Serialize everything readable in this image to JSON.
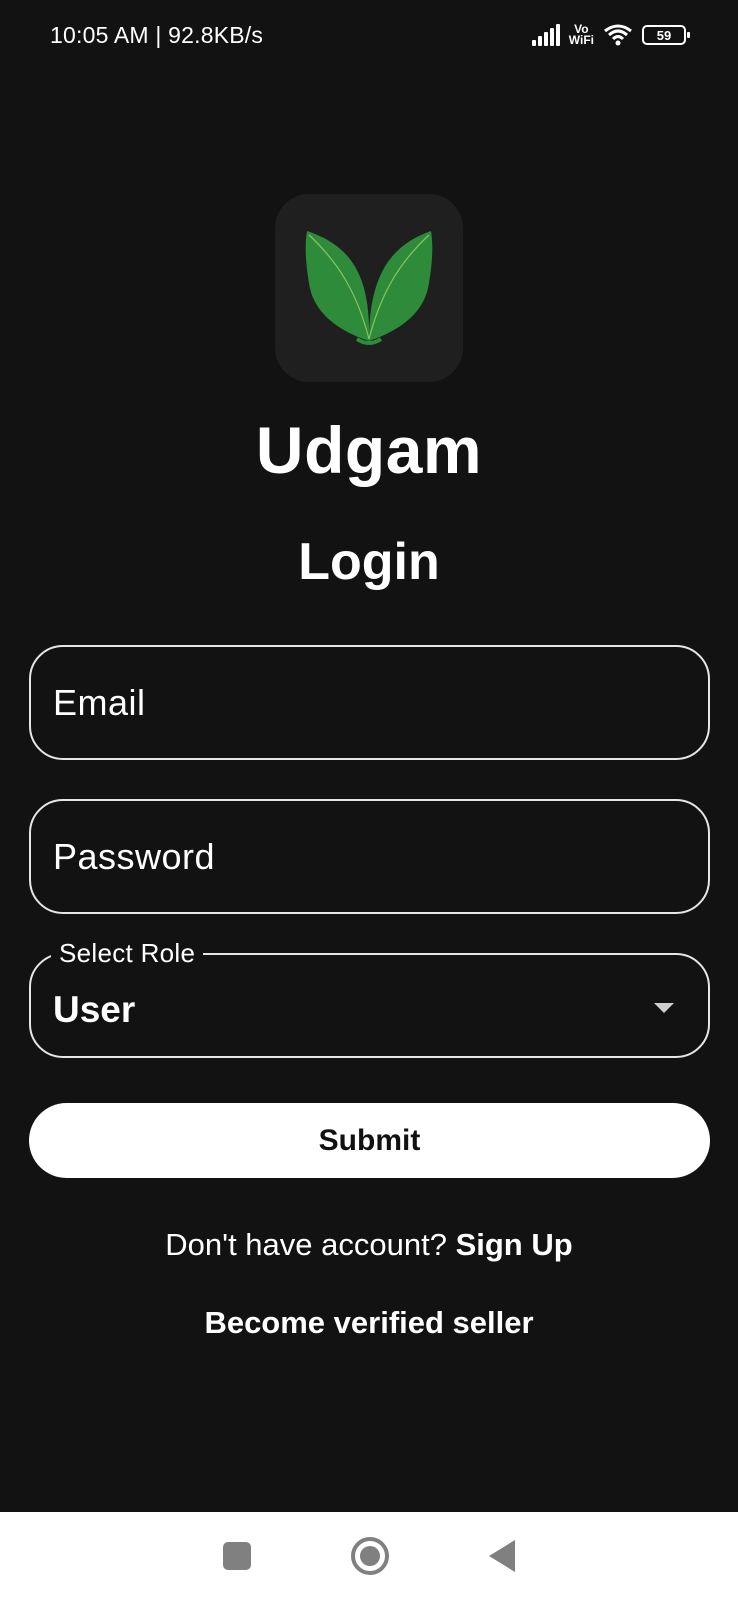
{
  "status_bar": {
    "time_speed": "10:05 AM | 92.8KB/s",
    "vowifi_top": "Vo",
    "vowifi_bottom": "WiFi",
    "battery_level": "59"
  },
  "app": {
    "name": "Udgam"
  },
  "login": {
    "title": "Login",
    "email_placeholder": "Email",
    "password_placeholder": "Password",
    "role_label": "Select Role",
    "role_value": "User",
    "submit_label": "Submit",
    "signup_prompt": "Don't have account? ",
    "signup_link": "Sign Up",
    "seller_link": "Become verified seller"
  },
  "icons": {
    "logo": "leaf-logo-icon",
    "dropdown": "chevron-down-icon",
    "nav_recents": "square-icon",
    "nav_home": "circle-icon",
    "nav_back": "back-triangle-icon"
  },
  "colors": {
    "background": "#121212",
    "leaf_green": "#2e8b3a",
    "text": "#ffffff"
  }
}
